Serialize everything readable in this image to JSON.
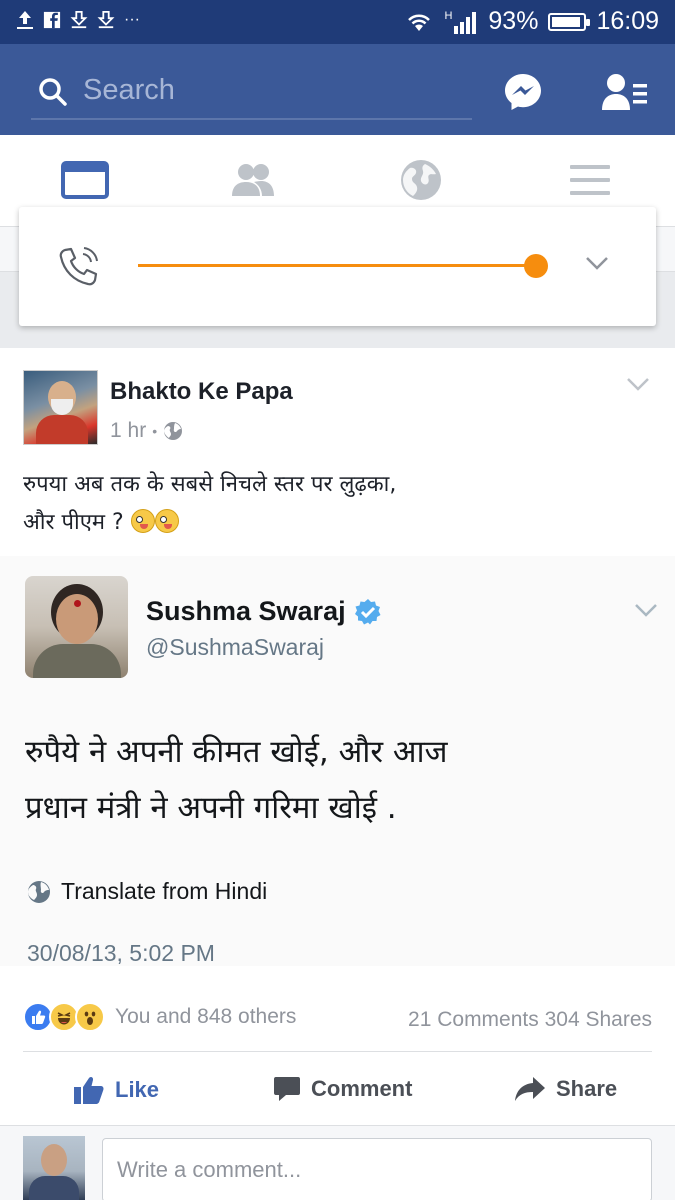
{
  "status_bar": {
    "signal_label": "H",
    "battery": "93%",
    "battery_level": 0.93,
    "time": "16:09",
    "overflow": "···"
  },
  "app_bar": {
    "search_placeholder": "Search"
  },
  "tabs": [
    {
      "icon": "news-feed-icon",
      "active": true
    },
    {
      "icon": "friends-icon",
      "active": false
    },
    {
      "icon": "globe-icon",
      "active": false
    },
    {
      "icon": "menu-icon",
      "active": false
    }
  ],
  "call_popup": {
    "progress": 1.0,
    "accent_color": "#f68d0e"
  },
  "post": {
    "author": "Bhakto Ke Papa",
    "time": "1 hr",
    "separator": "•",
    "text_line1": "रुपया अब तक के सबसे निचले स्तर पर लुढ़का,",
    "text_line2": "और पीएम ?",
    "tweet": {
      "name": "Sushma Swaraj",
      "handle": "@SushmaSwaraj",
      "text_line1": "रुपैये ने अपनी कीमत खोई, और आज",
      "text_line2": "प्रधान मंत्री ने अपनी गरिमा खोई .",
      "translate": "Translate from Hindi",
      "date": "30/08/13, 5:02 PM"
    },
    "reactions_text": "You and 848 others",
    "counts": "21 Comments 304 Shares",
    "actions": {
      "like": "Like",
      "comment": "Comment",
      "share": "Share"
    },
    "comment_placeholder": "Write a comment..."
  },
  "colors": {
    "facebook_blue": "#3b5998",
    "status_bar": "#1f3b78",
    "like_blue": "#4267b2",
    "verified": "#55acee"
  }
}
